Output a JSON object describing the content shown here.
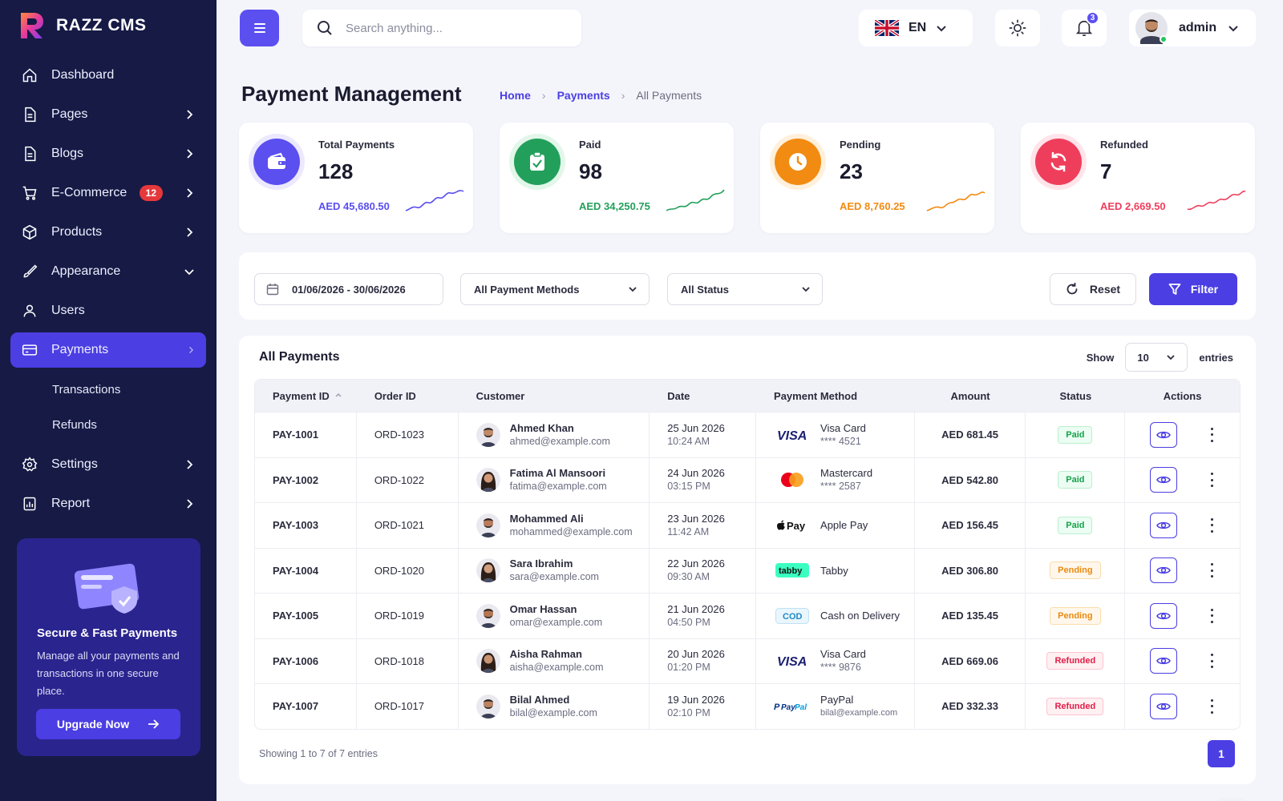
{
  "brand": {
    "name": "RAZZ CMS"
  },
  "sidebar": {
    "items": [
      {
        "label": "Dashboard"
      },
      {
        "label": "Pages"
      },
      {
        "label": "Blogs"
      },
      {
        "label": "E-Commerce",
        "badge": "12"
      },
      {
        "label": "Products"
      },
      {
        "label": "Appearance"
      },
      {
        "label": "Users"
      },
      {
        "label": "Payments"
      },
      {
        "label": "Settings"
      },
      {
        "label": "Report"
      }
    ],
    "sub_items": [
      {
        "label": "Transactions"
      },
      {
        "label": "Refunds"
      }
    ],
    "promo": {
      "title": "Secure & Fast Payments",
      "text": "Manage all your payments and transactions in one secure place.",
      "button": "Upgrade Now"
    }
  },
  "topbar": {
    "search_placeholder": "Search anything...",
    "language": "EN",
    "notifications_count": "3",
    "user": "admin"
  },
  "page": {
    "title": "Payment Management",
    "breadcrumb": [
      "Home",
      "Payments",
      "All Payments"
    ]
  },
  "stats": [
    {
      "label": "Total Payments",
      "value": "128",
      "amount": "AED 45,680.50",
      "color": "#5b4ff0",
      "icon": "wallet-icon"
    },
    {
      "label": "Paid",
      "value": "98",
      "amount": "AED 34,250.75",
      "color": "#22a05b",
      "icon": "clipboard-check-icon"
    },
    {
      "label": "Pending",
      "value": "23",
      "amount": "AED 8,760.25",
      "color": "#f28b12",
      "icon": "clock-icon"
    },
    {
      "label": "Refunded",
      "value": "7",
      "amount": "AED 2,669.50",
      "color": "#ef3e5c",
      "icon": "refresh-icon"
    }
  ],
  "filters": {
    "date_range": "01/06/2026 - 30/06/2026",
    "payment_method": "All Payment Methods",
    "status": "All Status",
    "reset": "Reset",
    "filter": "Filter"
  },
  "table": {
    "title": "All Payments",
    "show_label": "Show",
    "show_value": "10",
    "entries_label": "entries",
    "columns": [
      "Payment ID",
      "Order ID",
      "Customer",
      "Date",
      "Payment Method",
      "Amount",
      "Status",
      "Actions"
    ],
    "rows": [
      {
        "id": "PAY-1001",
        "order": "ORD-1023",
        "name": "Ahmed Khan",
        "email": "ahmed@example.com",
        "date": "25 Jun 2026",
        "time": "10:24 AM",
        "method": "Visa Card",
        "method_detail": "**** 4521",
        "logo": "visa",
        "amount": "AED 681.45",
        "status": "Paid"
      },
      {
        "id": "PAY-1002",
        "order": "ORD-1022",
        "name": "Fatima Al Mansoori",
        "email": "fatima@example.com",
        "date": "24 Jun 2026",
        "time": "03:15 PM",
        "method": "Mastercard",
        "method_detail": "**** 2587",
        "logo": "mastercard",
        "amount": "AED 542.80",
        "status": "Paid"
      },
      {
        "id": "PAY-1003",
        "order": "ORD-1021",
        "name": "Mohammed Ali",
        "email": "mohammed@example.com",
        "date": "23 Jun 2026",
        "time": "11:42 AM",
        "method": "Apple Pay",
        "method_detail": "",
        "logo": "applepay",
        "amount": "AED 156.45",
        "status": "Paid"
      },
      {
        "id": "PAY-1004",
        "order": "ORD-1020",
        "name": "Sara Ibrahim",
        "email": "sara@example.com",
        "date": "22 Jun 2026",
        "time": "09:30 AM",
        "method": "Tabby",
        "method_detail": "",
        "logo": "tabby",
        "amount": "AED 306.80",
        "status": "Pending"
      },
      {
        "id": "PAY-1005",
        "order": "ORD-1019",
        "name": "Omar Hassan",
        "email": "omar@example.com",
        "date": "21 Jun 2026",
        "time": "04:50 PM",
        "method": "Cash on Delivery",
        "method_detail": "",
        "logo": "cod",
        "amount": "AED 135.45",
        "status": "Pending"
      },
      {
        "id": "PAY-1006",
        "order": "ORD-1018",
        "name": "Aisha Rahman",
        "email": "aisha@example.com",
        "date": "20 Jun 2026",
        "time": "01:20 PM",
        "method": "Visa Card",
        "method_detail": "**** 9876",
        "logo": "visa",
        "amount": "AED 669.06",
        "status": "Refunded"
      },
      {
        "id": "PAY-1007",
        "order": "ORD-1017",
        "name": "Bilal Ahmed",
        "email": "bilal@example.com",
        "date": "19 Jun 2026",
        "time": "02:10 PM",
        "method": "PayPal",
        "method_detail": "bilal@example.com",
        "logo": "paypal",
        "amount": "AED 332.33",
        "status": "Refunded"
      }
    ],
    "footer": "Showing 1 to 7 of 7 entries",
    "current_page": "1"
  }
}
